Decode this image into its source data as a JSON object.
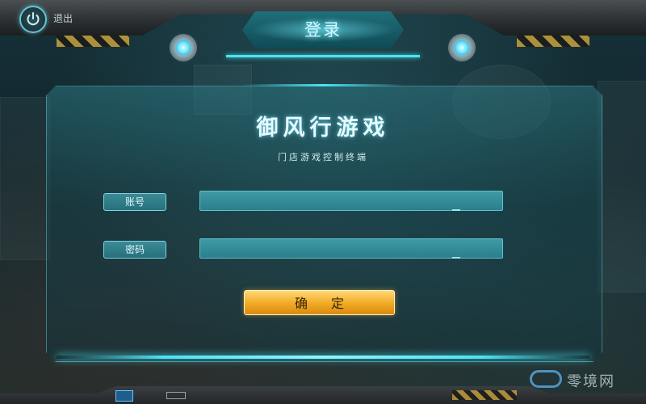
{
  "header": {
    "exit_label": "退出",
    "title": "登录"
  },
  "login": {
    "game_title": "御风行游戏",
    "subtitle": "门店游戏控制终端",
    "account_label": "账号",
    "account_value": "",
    "password_label": "密码",
    "password_value": "",
    "confirm_label": "确 定"
  },
  "watermark": {
    "text": "零境网"
  },
  "colors": {
    "accent": "#49e4f5",
    "button": "#f0a922",
    "panel": "#2a7f8b"
  },
  "icons": {
    "power": "power-icon",
    "lamp": "lamp-icon"
  }
}
